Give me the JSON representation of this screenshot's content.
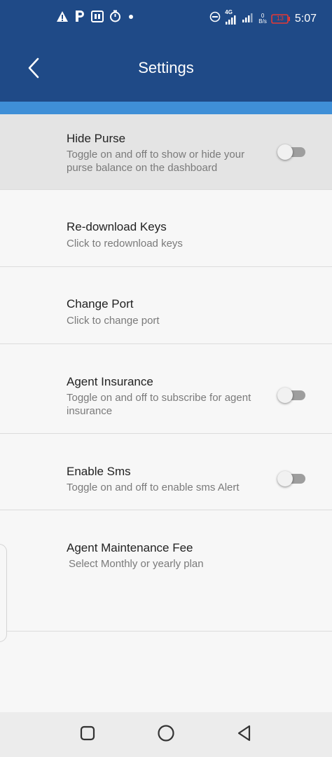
{
  "status_bar": {
    "time": "5:07",
    "icons": [
      "warning-icon",
      "parking-icon",
      "app-icon",
      "timer-icon",
      "dot-icon",
      "dnd-icon",
      "signal-4g-icon",
      "signal-icon",
      "data-speed-icon",
      "battery-icon"
    ],
    "battery_level": "13",
    "speed_value": "0",
    "speed_unit": "B/s",
    "network": "4G"
  },
  "header": {
    "title": "Settings",
    "back_icon": "chevron-left-icon"
  },
  "colors": {
    "header": "#1f4a87",
    "accent": "#3f8fd7",
    "battery": "#e53935"
  },
  "settings": [
    {
      "title": "Hide Purse",
      "subtitle": "Toggle on and off to show or hide your purse balance on the dashboard",
      "toggle": false
    },
    {
      "title": "Re-download Keys",
      "subtitle": "Click to redownload keys"
    },
    {
      "title": "Change Port",
      "subtitle": "Click to change port"
    },
    {
      "title": "Agent Insurance",
      "subtitle": "Toggle on and off to subscribe for agent insurance",
      "toggle": false
    },
    {
      "title": "Enable Sms",
      "subtitle": "Toggle on and off to enable sms Alert",
      "toggle": false
    },
    {
      "title": "Agent Maintenance Fee",
      "subtitle": "Select Monthly or yearly plan"
    }
  ],
  "nav_bar": {
    "icons": [
      "recents-square-icon",
      "home-circle-icon",
      "back-triangle-icon"
    ]
  }
}
